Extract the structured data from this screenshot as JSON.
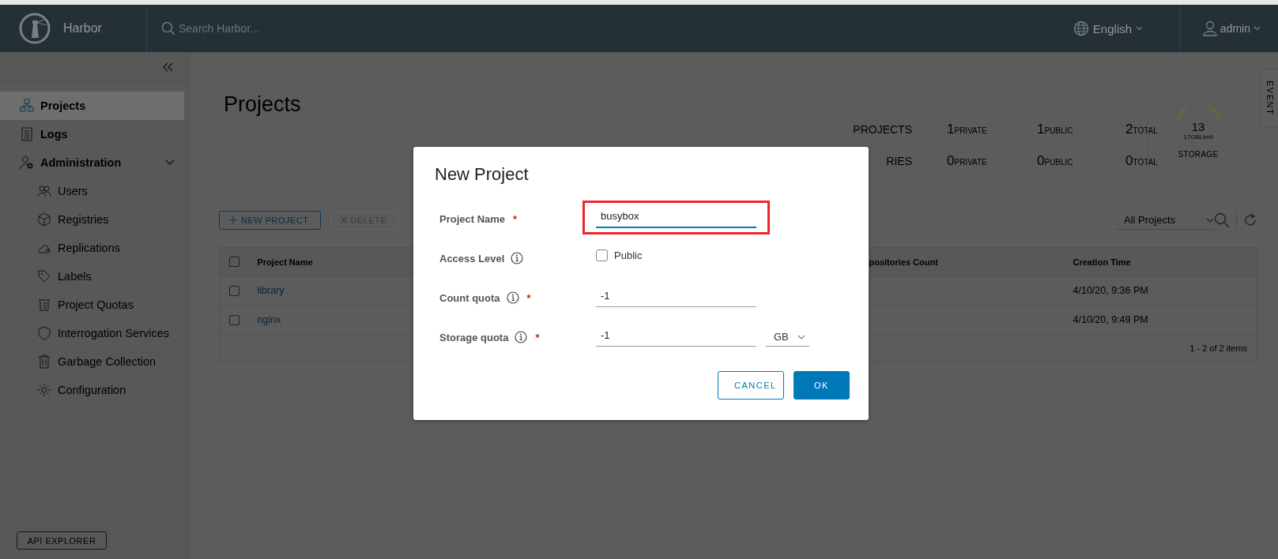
{
  "top_bar": {
    "app_name": "Harbor",
    "search": {
      "placeholder": "Search Harbor..."
    },
    "language": "English",
    "user": "admin"
  },
  "sidebar": {
    "items": [
      {
        "label": "Projects",
        "selected": true
      },
      {
        "label": "Logs",
        "selected": false
      },
      {
        "label": "Administration",
        "selected": false,
        "expanded": true,
        "children": [
          {
            "label": "Users",
            "selected": false
          },
          {
            "label": "Registries",
            "selected": false
          },
          {
            "label": "Replications",
            "selected": false
          },
          {
            "label": "Labels",
            "selected": false
          },
          {
            "label": "Project Quotas",
            "selected": false
          },
          {
            "label": "Interrogation Services",
            "selected": false
          },
          {
            "label": "Garbage Collection",
            "selected": false
          },
          {
            "label": "Configuration",
            "selected": false
          }
        ]
      }
    ],
    "api_explorer": "API EXPLORER"
  },
  "event_tab": "EVENT",
  "page": {
    "title": "Projects"
  },
  "summary": {
    "rows": [
      {
        "label": "PROJECTS",
        "private": "1",
        "private_label": "PRIVATE",
        "public": "1",
        "public_label": "PUBLIC",
        "total": "2",
        "total_label": "TOTAL"
      },
      {
        "label": "RIES",
        "private": "0",
        "private_label": "PRIVATE",
        "public": "0",
        "public_label": "PUBLIC",
        "total": "0",
        "total_label": "TOTAL"
      }
    ],
    "storage": {
      "value": "13",
      "limit": "17GBLimit",
      "label": "STORAGE"
    }
  },
  "toolbar": {
    "new_project": "NEW PROJECT",
    "delete": {
      "label": "DELETE",
      "disabled": true
    },
    "filter": "All Projects"
  },
  "table": {
    "select_all": false,
    "columns": [
      "Project Name",
      "positories Count",
      "Creation Time"
    ],
    "rows": [
      {
        "checked": false,
        "name": "library",
        "created": "4/10/20, 9:36 PM"
      },
      {
        "checked": false,
        "name": "nginx",
        "created": "4/10/20, 9:49 PM"
      }
    ],
    "footer": "1 - 2 of 2 items"
  },
  "dialog": {
    "title": "New Project",
    "fields": [
      {
        "kind": "text",
        "label": "Project Name",
        "info": false,
        "required_mark": "*",
        "value": "busybox",
        "focused": true,
        "highlighted": true
      },
      {
        "kind": "checkbox",
        "label": "Access Level",
        "info": true,
        "option": "Public",
        "checked": false
      },
      {
        "kind": "text",
        "label": "Count quota",
        "info": true,
        "required_mark": "*",
        "value": "-1",
        "focused": false,
        "highlighted": false
      },
      {
        "kind": "text_unit",
        "label": "Storage quota",
        "info": true,
        "required_mark": "*",
        "value": "-1",
        "unit": "GB",
        "focused": false,
        "highlighted": false
      }
    ],
    "buttons": [
      {
        "label": "CANCEL",
        "primary": false
      },
      {
        "label": "OK",
        "primary": true
      }
    ]
  }
}
